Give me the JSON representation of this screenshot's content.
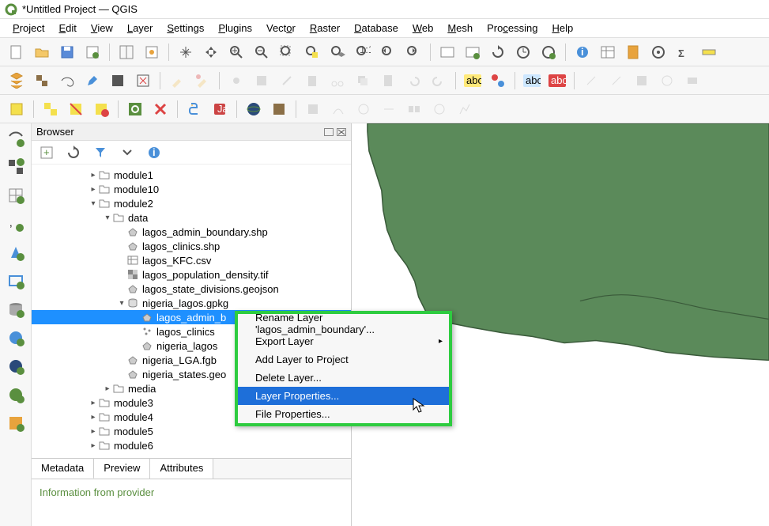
{
  "window": {
    "title": "*Untitled Project — QGIS"
  },
  "menu": {
    "items": [
      "Project",
      "Edit",
      "View",
      "Layer",
      "Settings",
      "Plugins",
      "Vector",
      "Raster",
      "Database",
      "Web",
      "Mesh",
      "Processing",
      "Help"
    ]
  },
  "browser": {
    "title": "Browser",
    "tree": [
      {
        "indent": 4,
        "caret": "▸",
        "icon": "folder",
        "label": "module1"
      },
      {
        "indent": 4,
        "caret": "▸",
        "icon": "folder",
        "label": "module10"
      },
      {
        "indent": 4,
        "caret": "▾",
        "icon": "folder",
        "label": "module2"
      },
      {
        "indent": 5,
        "caret": "▾",
        "icon": "folder",
        "label": "data"
      },
      {
        "indent": 6,
        "caret": "",
        "icon": "poly",
        "label": "lagos_admin_boundary.shp"
      },
      {
        "indent": 6,
        "caret": "",
        "icon": "poly",
        "label": "lagos_clinics.shp"
      },
      {
        "indent": 6,
        "caret": "",
        "icon": "table",
        "label": "lagos_KFC.csv"
      },
      {
        "indent": 6,
        "caret": "",
        "icon": "raster",
        "label": "lagos_population_density.tif"
      },
      {
        "indent": 6,
        "caret": "",
        "icon": "poly",
        "label": "lagos_state_divisions.geojson"
      },
      {
        "indent": 6,
        "caret": "▾",
        "icon": "gpkg",
        "label": "nigeria_lagos.gpkg"
      },
      {
        "indent": 7,
        "caret": "",
        "icon": "poly",
        "label": "lagos_admin_b",
        "selected": true
      },
      {
        "indent": 7,
        "caret": "",
        "icon": "point",
        "label": "lagos_clinics"
      },
      {
        "indent": 7,
        "caret": "",
        "icon": "poly",
        "label": "nigeria_lagos"
      },
      {
        "indent": 6,
        "caret": "",
        "icon": "poly",
        "label": "nigeria_LGA.fgb"
      },
      {
        "indent": 6,
        "caret": "",
        "icon": "poly",
        "label": "nigeria_states.geo"
      },
      {
        "indent": 5,
        "caret": "▸",
        "icon": "folder",
        "label": "media"
      },
      {
        "indent": 4,
        "caret": "▸",
        "icon": "folder",
        "label": "module3"
      },
      {
        "indent": 4,
        "caret": "▸",
        "icon": "folder",
        "label": "module4"
      },
      {
        "indent": 4,
        "caret": "▸",
        "icon": "folder",
        "label": "module5"
      },
      {
        "indent": 4,
        "caret": "▸",
        "icon": "folder",
        "label": "module6"
      }
    ],
    "tabs": {
      "metadata": "Metadata",
      "preview": "Preview",
      "attributes": "Attributes"
    },
    "info_heading": "Information from provider"
  },
  "context": {
    "items": [
      {
        "label": "Rename Layer 'lagos_admin_boundary'..."
      },
      {
        "label": "Export Layer",
        "sub": true
      },
      {
        "label": "Add Layer to Project"
      },
      {
        "label": "Delete Layer..."
      },
      {
        "label": "Layer Properties...",
        "hl": true
      },
      {
        "label": "File Properties..."
      }
    ]
  }
}
